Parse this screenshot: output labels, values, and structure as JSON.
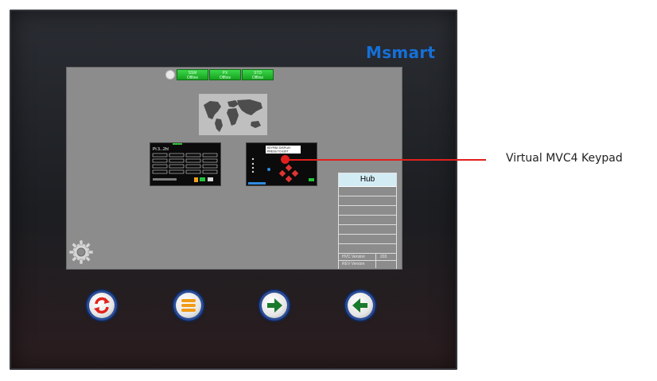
{
  "device": {
    "brand": "Msmart"
  },
  "status_bar": {
    "boxes": [
      {
        "top": "SSM",
        "bottom": "Offline"
      },
      {
        "top": "PX",
        "bottom": "Offline"
      },
      {
        "top": "STD",
        "bottom": "Offline"
      }
    ]
  },
  "hub_panel": {
    "title": "Hub",
    "footer": [
      {
        "label": "HVC Version",
        "value": "203"
      },
      {
        "label": "REV Version",
        "value": ""
      }
    ]
  },
  "thumbnail_a": {
    "header": "Pt 3...2hl"
  },
  "thumbnail_b": {
    "lines": [
      "KEYPAD DISPLAY",
      "PRESS TO EDIT"
    ]
  },
  "hardware_buttons": [
    {
      "icon": "refresh-icon",
      "color": "#e0241c"
    },
    {
      "icon": "menu-icon",
      "color": "#f29b16"
    },
    {
      "icon": "arrow-right-icon",
      "color": "#1a7a2c"
    },
    {
      "icon": "arrow-left-icon",
      "color": "#1a7a2c"
    }
  ],
  "callout": {
    "label": "Virtual MVC4 Keypad",
    "color": "#e0201d"
  }
}
